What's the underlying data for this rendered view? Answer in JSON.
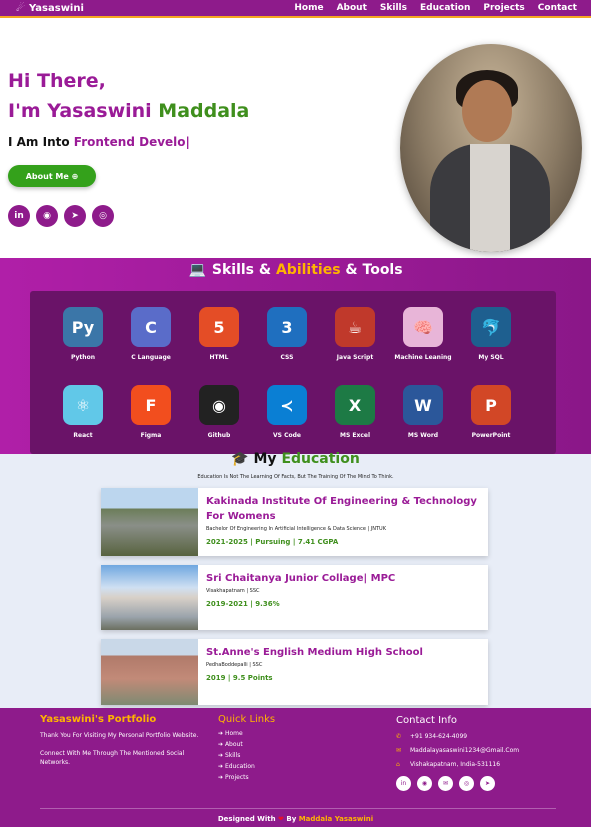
{
  "nav": {
    "brand": "Yasaswini",
    "links": [
      "Home",
      "About",
      "Skills",
      "Education",
      "Projects",
      "Contact"
    ]
  },
  "hero": {
    "greeting": "Hi There,",
    "name_prefix": "I'm Yasaswini ",
    "name_highlight": "Maddala",
    "intro_prefix": "I Am Into ",
    "intro_typed": "Frontend Develo|",
    "about_button": "About Me ⊕",
    "social_icons": [
      "in",
      "◉",
      "➤",
      "◎"
    ]
  },
  "skills": {
    "title_prefix": "Skills & ",
    "title_highlight": "Abilities",
    "title_suffix": " & Tools",
    "items": [
      {
        "label": "Python",
        "glyph": "Py",
        "color": "#3b76a8"
      },
      {
        "label": "C Language",
        "glyph": "C",
        "color": "#5a6cc9"
      },
      {
        "label": "HTML",
        "glyph": "5",
        "color": "#e44d26"
      },
      {
        "label": "CSS",
        "glyph": "3",
        "color": "#1f6fbf"
      },
      {
        "label": "Java Script",
        "glyph": "☕",
        "color": "#c0392b"
      },
      {
        "label": "Machine Leaning",
        "glyph": "🧠",
        "color": "#e8b5d8"
      },
      {
        "label": "My SQL",
        "glyph": "🐬",
        "color": "#1e5f8f"
      },
      {
        "label": "React",
        "glyph": "⚛",
        "color": "#61c8e8"
      },
      {
        "label": "Figma",
        "glyph": "F",
        "color": "#f24e1e"
      },
      {
        "label": "Github",
        "glyph": "◉",
        "color": "#222222"
      },
      {
        "label": "VS Code",
        "glyph": "≺",
        "color": "#0a7fd4"
      },
      {
        "label": "MS Excel",
        "glyph": "X",
        "color": "#1d7a45"
      },
      {
        "label": "MS Word",
        "glyph": "W",
        "color": "#2b579a"
      },
      {
        "label": "PowerPoint",
        "glyph": "P",
        "color": "#d24726"
      }
    ]
  },
  "education": {
    "title_icon": "🎓",
    "title_prefix": "My ",
    "title_highlight": "Education",
    "subtitle": "Education Is Not The Learning Of Facts, But The Training Of The Mind To Think.",
    "items": [
      {
        "title": "Kakinada Institute Of Engineering & Technology For Womens",
        "detail": "Bachelor Of Engineering In Artificial Intelligence & Data Science | JNTUK",
        "meta": "2021-2025 | Pursuing | 7.41 CGPA"
      },
      {
        "title": "Sri Chaitanya Junior Collage| MPC",
        "detail": "Visakhapatnam | SSC",
        "meta": "2019-2021 | 9.36%"
      },
      {
        "title": "St.Anne's English Medium High School",
        "detail": "PedhaBoddepalli | SSC",
        "meta": "2019 | 9.5 Points"
      }
    ]
  },
  "footer": {
    "portfolio_title": "Yasaswini's Portfolio",
    "thanks": "Thank You For Visiting My Personal Portfolio Website.",
    "connect": "Connect With Me Through The Mentioned Social Networks.",
    "quick_title": "Quick Links",
    "quick_links": [
      "Home",
      "About",
      "Skills",
      "Education",
      "Projects"
    ],
    "contact_title": "Contact Info",
    "phone": "+91 934-624-4099",
    "email": "Maddalayasaswini1234@Gmail.Com",
    "location": "Vishakapatnam, India-531116",
    "credit_prefix": "Designed With ",
    "credit_heart": "❤",
    "credit_by": " By ",
    "credit_name": "Maddala Yasaswini"
  },
  "colors": {
    "primary": "#8e1b8b",
    "accent": "#ffb400",
    "green": "#3f8f1d"
  }
}
